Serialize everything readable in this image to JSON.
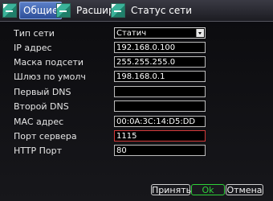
{
  "tabs": [
    {
      "label": "Общие",
      "active": true
    },
    {
      "label": "Расшир",
      "active": false
    },
    {
      "label": "Статус сети",
      "active": false
    }
  ],
  "form": {
    "network_type": {
      "label": "Тип сети",
      "value": "Статич"
    },
    "ip_address": {
      "label": "IP адрес",
      "value": "192.168.0.100"
    },
    "subnet_mask": {
      "label": "Маска подсети",
      "value": "255.255.255.0"
    },
    "gateway": {
      "label": "Шлюз по умолч",
      "value": "198.168.0.1"
    },
    "primary_dns": {
      "label": "Первый DNS",
      "value": ""
    },
    "secondary_dns": {
      "label": "Второй DNS",
      "value": ""
    },
    "mac_address": {
      "label": "MAC адрес",
      "value": "00:0A:3C:14:D5:DD"
    },
    "server_port": {
      "label": "Порт сервера",
      "value": "1115"
    },
    "http_port": {
      "label": "HTTP Порт",
      "value": "80"
    }
  },
  "buttons": {
    "apply": "Принять",
    "ok": "Ok",
    "cancel": "Отмена"
  },
  "colors": {
    "active_tab": "#3f63b0",
    "focus_border": "#d43a3a",
    "ok_text": "#2fd13a"
  }
}
